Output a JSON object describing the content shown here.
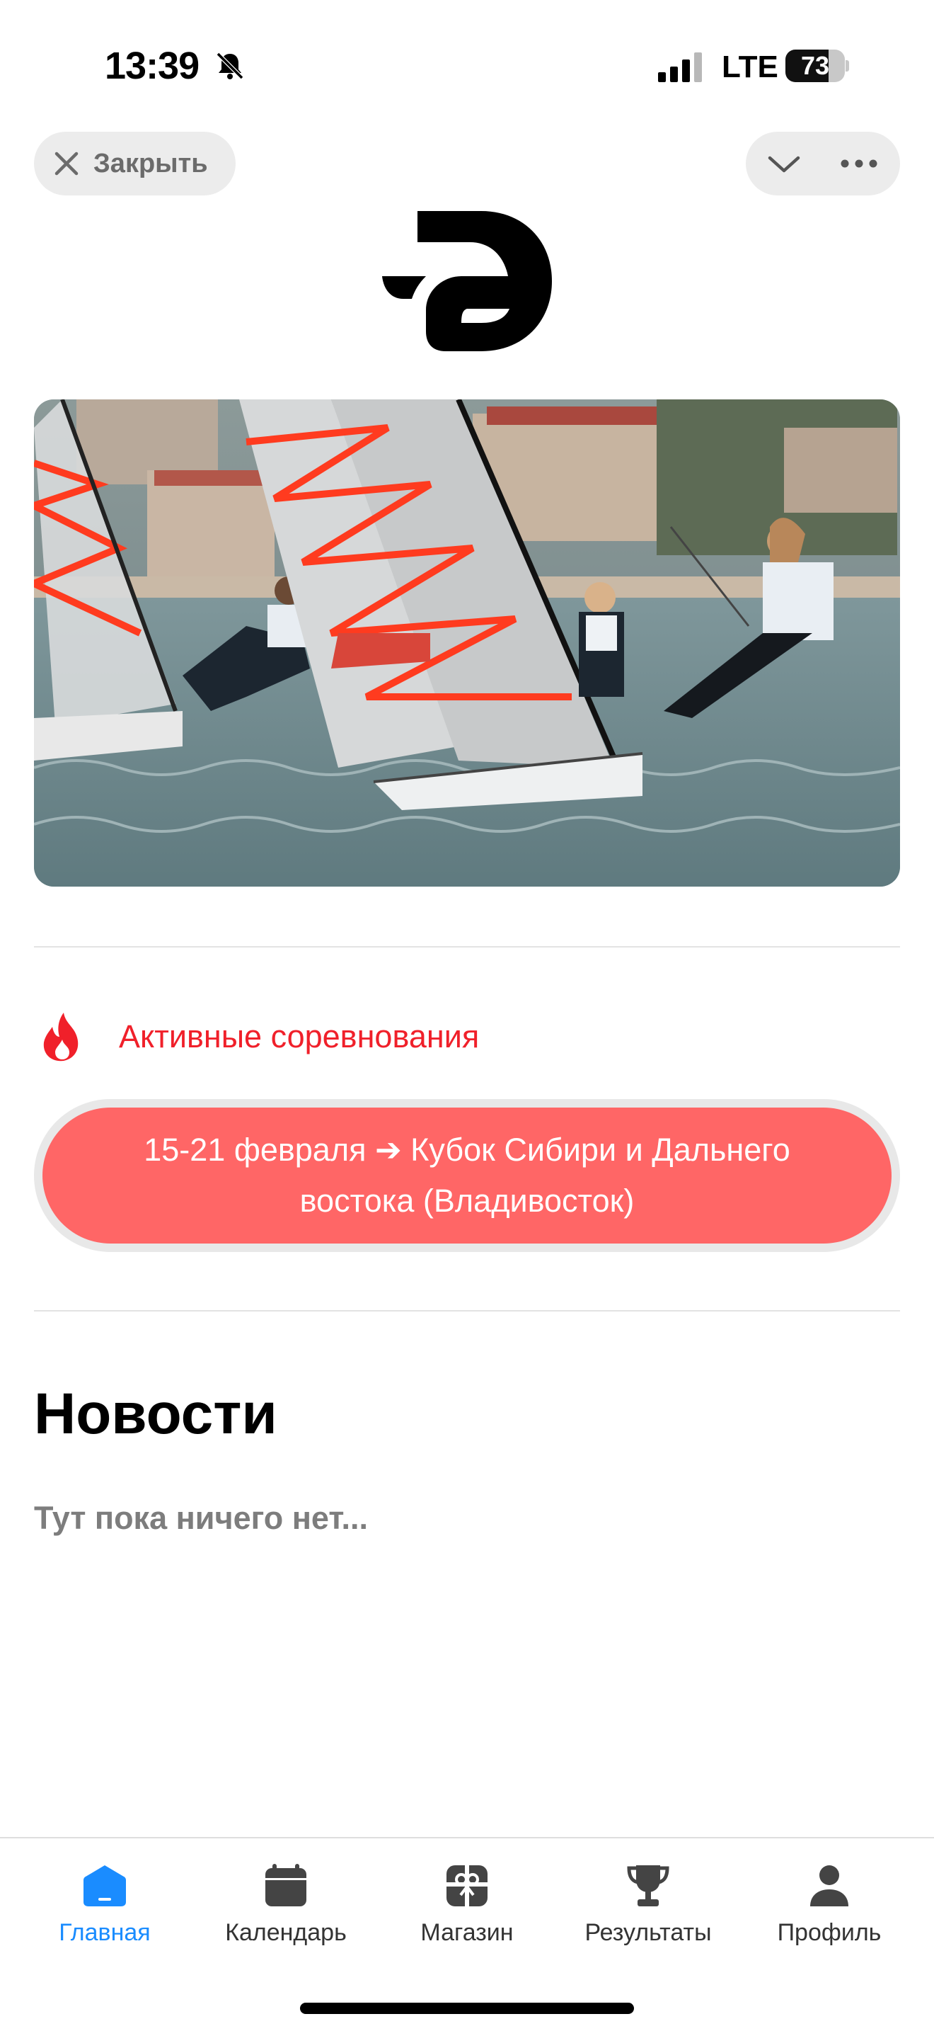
{
  "status_bar": {
    "time": "13:39",
    "network": "LTE",
    "battery": "73",
    "battery_level": 0.73,
    "icons": [
      "bell-slash-icon",
      "signal-icon",
      "battery-icon"
    ]
  },
  "top_bar": {
    "close_label": "Закрыть",
    "icons": [
      "close-icon",
      "chevron-down-icon",
      "more-icon"
    ]
  },
  "hero": {
    "description_icon": "sailing-photo"
  },
  "active": {
    "title": "Активные соревнования",
    "icon": "fire-icon",
    "event_label": "15-21 февраля ➔ Кубок Сибири и Дальнего востока (Владивосток)"
  },
  "news": {
    "title": "Новости",
    "empty_text": "Тут пока ничего нет..."
  },
  "tabs": [
    {
      "label": "Главная",
      "icon": "home-icon",
      "active": true
    },
    {
      "label": "Календарь",
      "icon": "calendar-icon",
      "active": false
    },
    {
      "label": "Магазин",
      "icon": "gift-icon",
      "active": false
    },
    {
      "label": "Результаты",
      "icon": "trophy-icon",
      "active": false
    },
    {
      "label": "Профиль",
      "icon": "profile-icon",
      "active": false
    }
  ],
  "colors": {
    "accent": "#1a8cff",
    "fire": "#f0202a",
    "event_button": "#ff6666"
  }
}
